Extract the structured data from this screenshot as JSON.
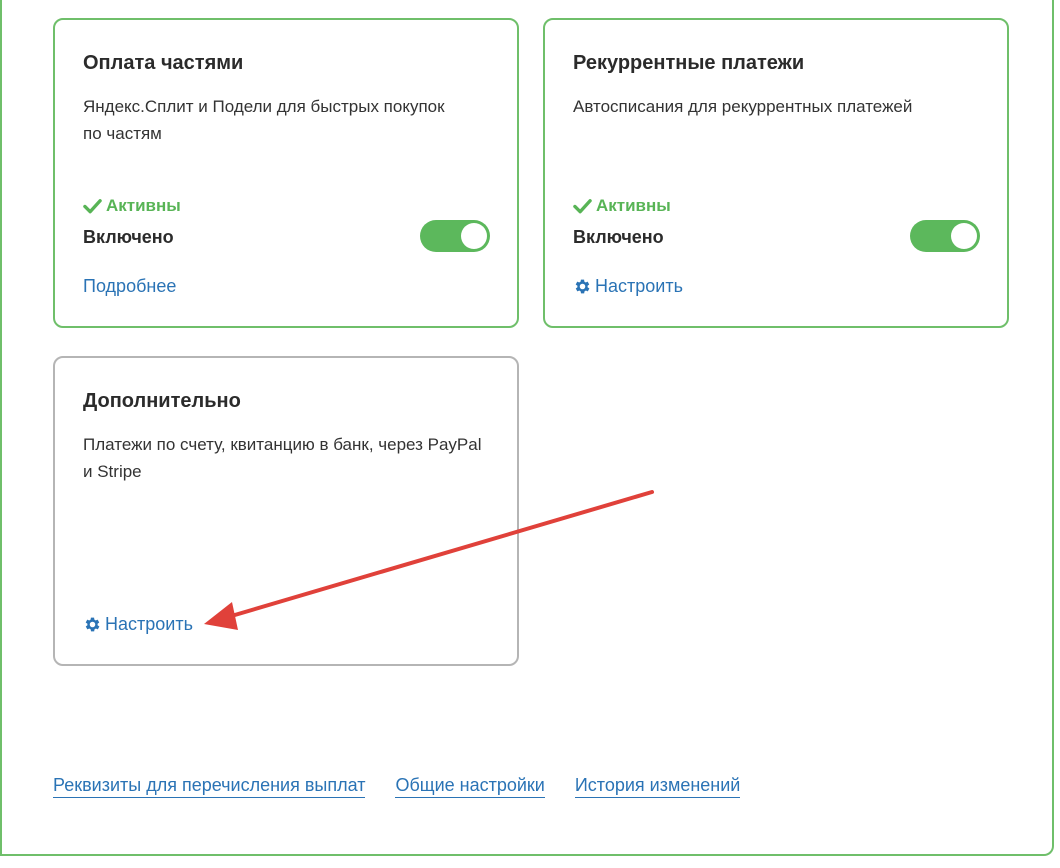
{
  "cards": [
    {
      "title": "Оплата частями",
      "description": "Яндекс.Сплит и Подели для быстрых покупок по частям",
      "status": "Активны",
      "enabled_label": "Включено",
      "link_label": "Подробнее"
    },
    {
      "title": "Рекуррентные платежи",
      "description": "Автосписания для рекуррентных платежей",
      "status": "Активны",
      "enabled_label": "Включено",
      "link_label": "Настроить"
    },
    {
      "title": "Дополнительно",
      "description": "Платежи по счету, квитанцию в банк, через PayPal и Stripe",
      "link_label": "Настроить"
    }
  ],
  "footer": {
    "links": [
      "Реквизиты для перечисления выплат",
      "Общие настройки",
      "История изменений"
    ]
  },
  "colors": {
    "accent_green": "#5cb85c",
    "link_blue": "#2a73b5",
    "annotation_red": "#e0413a"
  },
  "icons": {
    "check": "check-icon",
    "gear": "gear-icon"
  }
}
